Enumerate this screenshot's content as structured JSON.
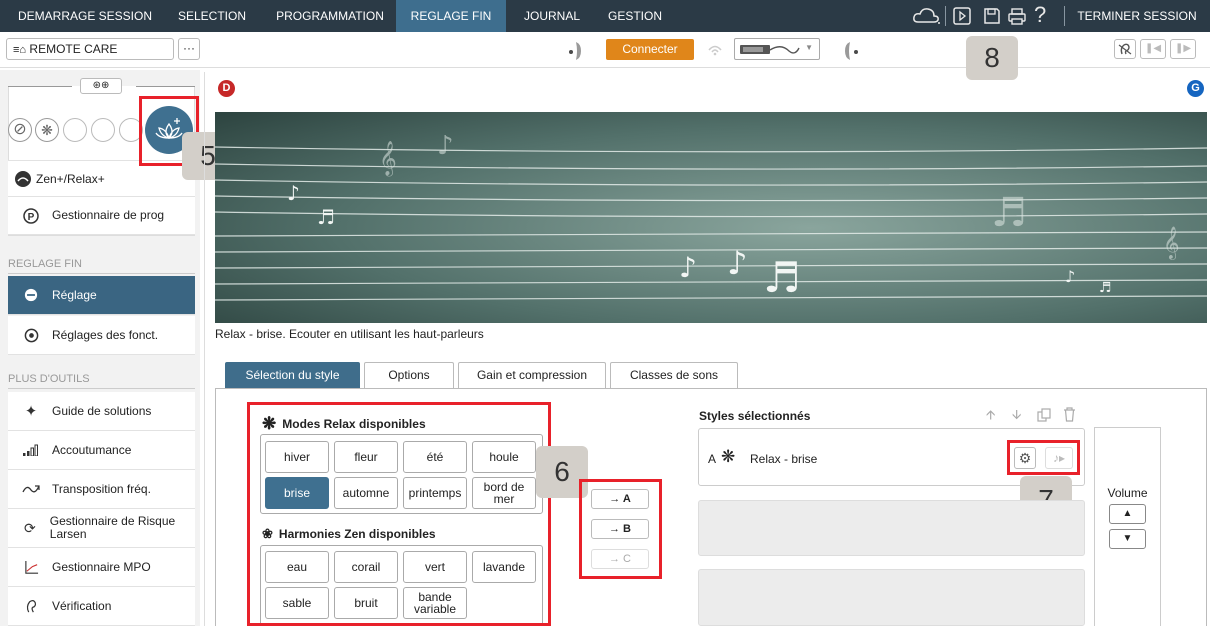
{
  "nav": {
    "items": [
      "DEMARRAGE SESSION",
      "SELECTION",
      "PROGRAMMATION",
      "REGLAGE FIN",
      "JOURNAL",
      "GESTION"
    ],
    "active": "REGLAGE FIN",
    "end_session": "TERMINER SESSION",
    "icons": [
      "cloud-icon",
      "play-icon",
      "save-icon",
      "print-icon",
      "help-icon"
    ]
  },
  "toolbar": {
    "remote_care": "REMOTE CARE",
    "more": "···",
    "connect": "Connecter"
  },
  "sides": {
    "right": "D",
    "left": "G"
  },
  "sidebar": {
    "program_label": "Zen+/Relax+",
    "prog_manager": "Gestionnaire de prog",
    "section_fine": "REGLAGE FIN",
    "fine_items": [
      "Réglage",
      "Réglages des fonct."
    ],
    "section_tools": "PLUS D'OUTILS",
    "tool_items": [
      "Guide de solutions",
      "Accoutumance",
      "Transposition fréq.",
      "Gestionnaire de Risque Larsen",
      "Gestionnaire MPO",
      "Vérification"
    ]
  },
  "caption": "Relax - brise. Ecouter en utilisant les haut-parleurs",
  "tabs": [
    "Sélection du style",
    "Options",
    "Gain et compression",
    "Classes de sons"
  ],
  "relax": {
    "title": "Modes Relax disponibles",
    "row1": [
      "hiver",
      "fleur",
      "été",
      "houle"
    ],
    "row2": [
      "brise",
      "automne",
      "printemps",
      "bord de mer"
    ],
    "selected": "brise"
  },
  "zen": {
    "title": "Harmonies Zen disponibles",
    "row1": [
      "eau",
      "corail",
      "vert",
      "lavande"
    ],
    "row2": [
      "sable",
      "bruit",
      "bande variable"
    ]
  },
  "assign": [
    "→ A",
    "→ B",
    "→ C"
  ],
  "styles": {
    "title": "Styles sélectionnés",
    "slot_a_letter": "A",
    "slot_a_name": "Relax - brise"
  },
  "volume": {
    "label": "Volume",
    "up": "▲",
    "down": "▼"
  },
  "callouts": [
    "5",
    "6",
    "7",
    "8"
  ],
  "colors": {
    "nav_bg": "#2b3a46",
    "accent": "#3f7090",
    "connect": "#e0861a",
    "callout_red": "#e8212a"
  }
}
